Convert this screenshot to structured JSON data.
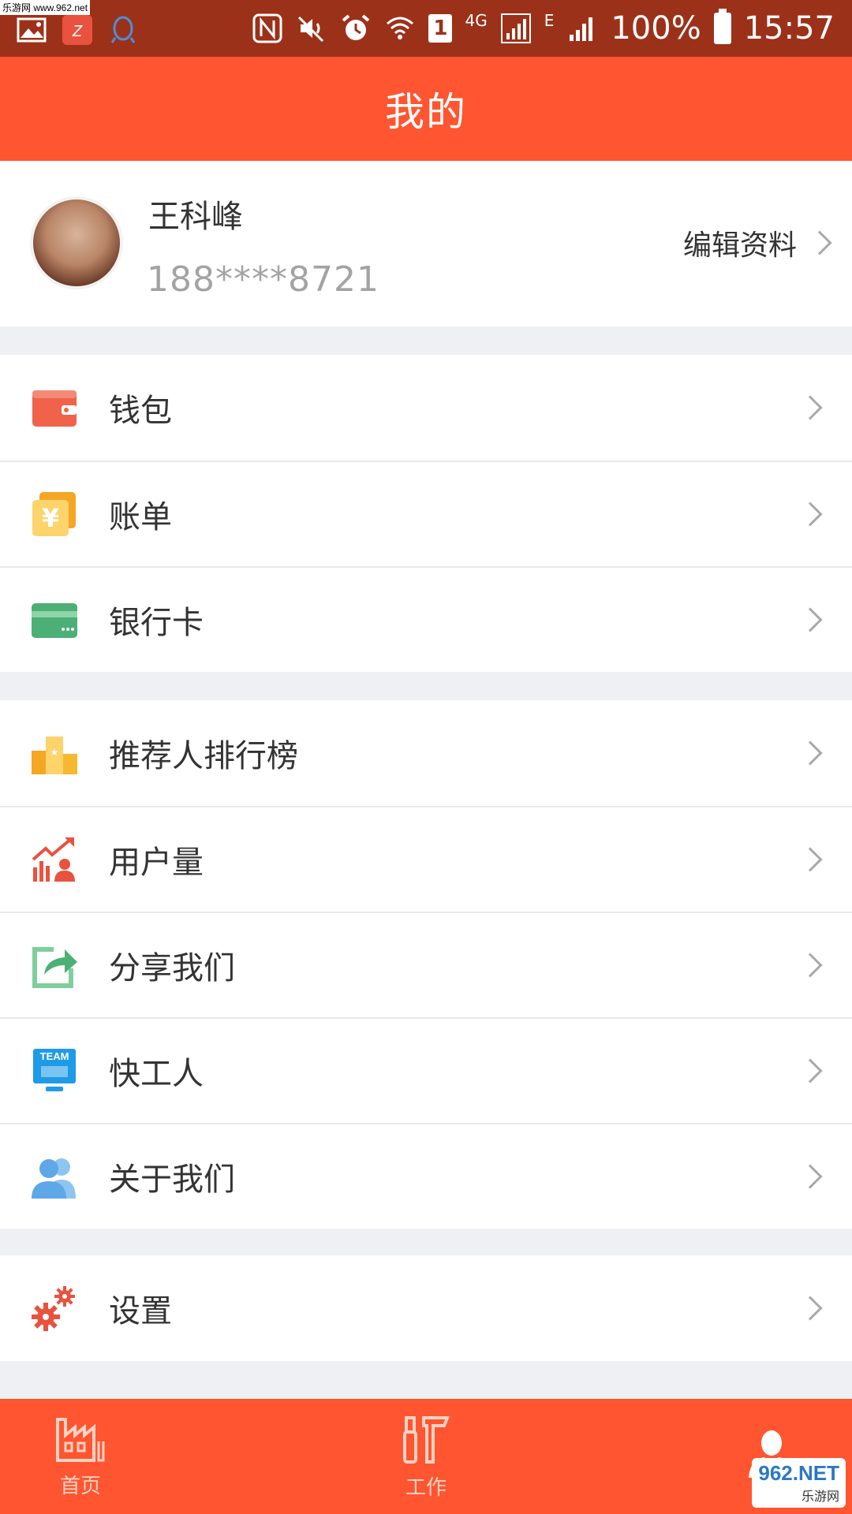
{
  "watermark": {
    "top": "乐游网 www.962.net",
    "bottom": "962.NET",
    "bottom_sub": "乐游网"
  },
  "status_bar": {
    "network": "4G",
    "network2": "E",
    "battery": "100%",
    "time": "15:57",
    "sim": "1"
  },
  "header": {
    "title": "我的"
  },
  "profile": {
    "name": "王科峰",
    "phone": "188****8721",
    "edit_label": "编辑资料"
  },
  "menu": {
    "group1": [
      {
        "label": "钱包",
        "icon": "wallet-icon",
        "color": "#f0624a"
      },
      {
        "label": "账单",
        "icon": "bill-icon",
        "color": "#f7b731"
      },
      {
        "label": "银行卡",
        "icon": "bank-card-icon",
        "color": "#4caf76"
      }
    ],
    "group2": [
      {
        "label": "推荐人排行榜",
        "icon": "leaderboard-icon",
        "color": "#f5a623"
      },
      {
        "label": "用户量",
        "icon": "user-growth-icon",
        "color": "#e8523f"
      },
      {
        "label": "分享我们",
        "icon": "share-icon",
        "color": "#4caf76"
      },
      {
        "label": "快工人",
        "icon": "team-icon",
        "color": "#1e9be8",
        "badge": "TEAM"
      },
      {
        "label": "关于我们",
        "icon": "about-us-icon",
        "color": "#5fa8e8"
      }
    ],
    "group3": [
      {
        "label": "设置",
        "icon": "settings-icon",
        "color": "#e8523f"
      }
    ]
  },
  "bottom_nav": [
    {
      "label": "首页",
      "icon": "factory-icon"
    },
    {
      "label": "工作",
      "icon": "tools-icon"
    },
    {
      "label": "",
      "icon": "profile-icon",
      "active": true
    }
  ],
  "colors": {
    "accent": "#ff5530",
    "status_bar": "#9c3119"
  }
}
